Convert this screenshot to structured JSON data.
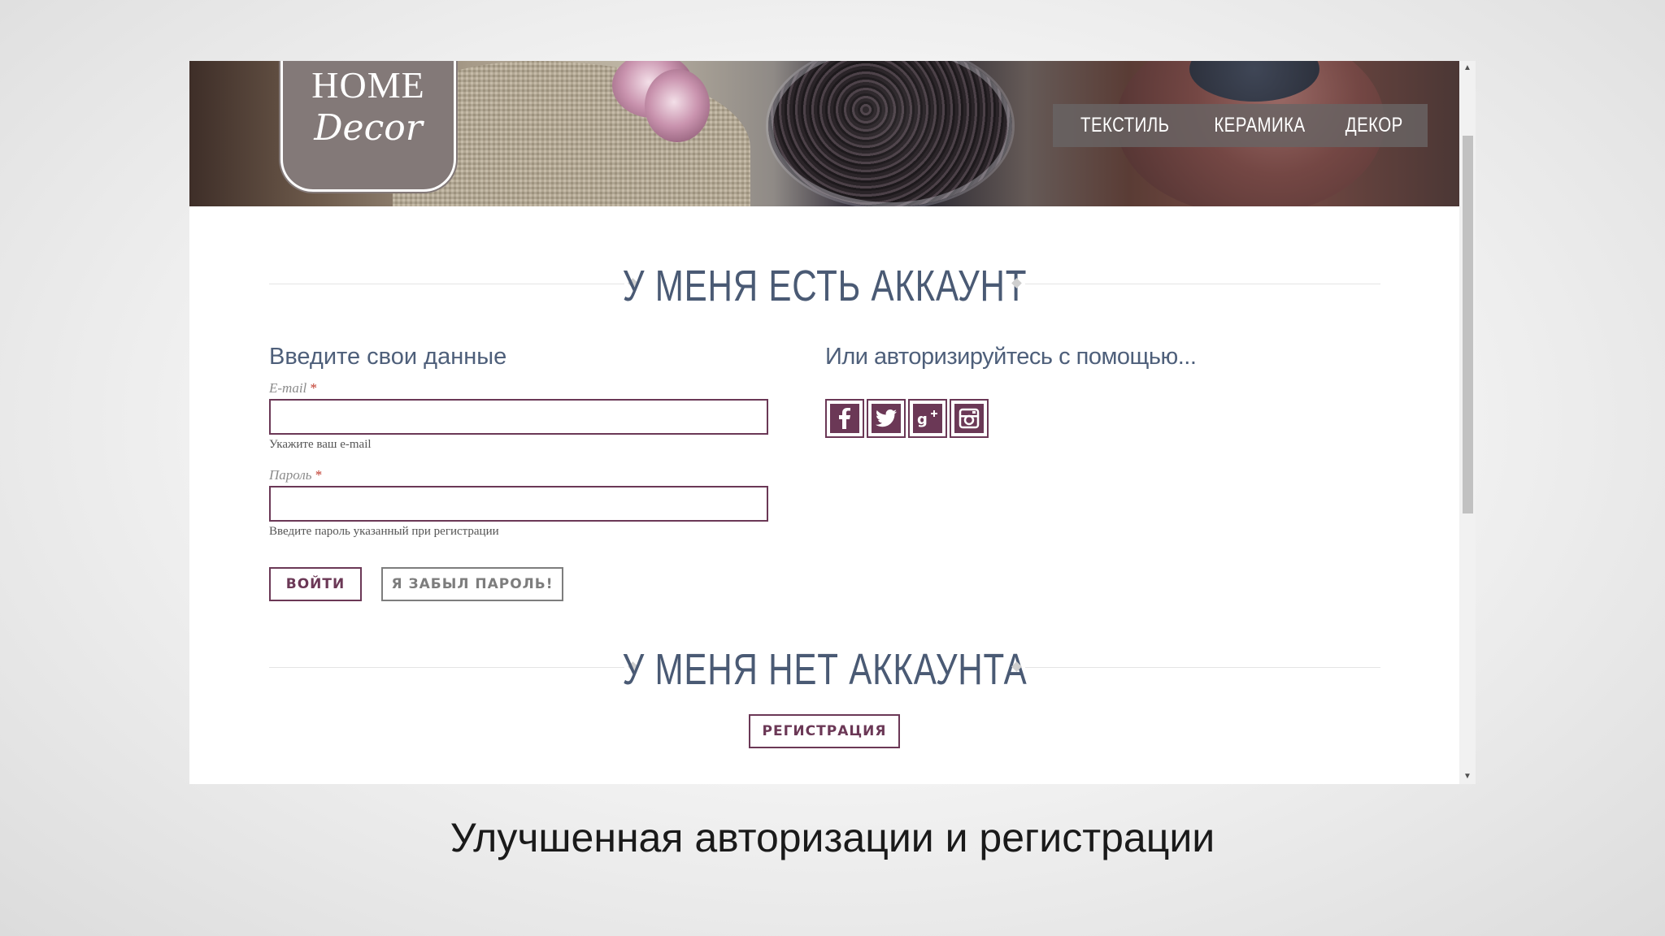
{
  "header": {
    "logo_line1": "HOME",
    "logo_line2": "Decor",
    "nav_items": [
      "ТЕКСТИЛЬ",
      "КЕРАМИКА",
      "ДЕКОР"
    ]
  },
  "login_section": {
    "heading": "У МЕНЯ ЕСТЬ АККАУНТ",
    "left_title": "Введите свои данные",
    "email_label": "E-mail",
    "email_value": "",
    "email_hint": "Укажите ваш e-mail",
    "password_label": "Пароль",
    "password_value": "",
    "password_hint": "Введите пароль указанный при регистрации",
    "required_mark": "*",
    "login_button": "ВОЙТИ",
    "forgot_button": "Я ЗАБЫЛ ПАРОЛЬ!",
    "right_title": "Или авторизируйтесь с помощью...",
    "social_icons": [
      "facebook-icon",
      "twitter-icon",
      "google-plus-icon",
      "instagram-icon"
    ]
  },
  "register_section": {
    "heading": "У МЕНЯ НЕТ АККАУНТА",
    "register_button": "РЕГИСТРАЦИЯ"
  },
  "caption": "Улучшенная авторизации и регистрации",
  "colors": {
    "accent": "#6b3856",
    "heading": "#4a5a74",
    "nav_bg": "#696464"
  }
}
